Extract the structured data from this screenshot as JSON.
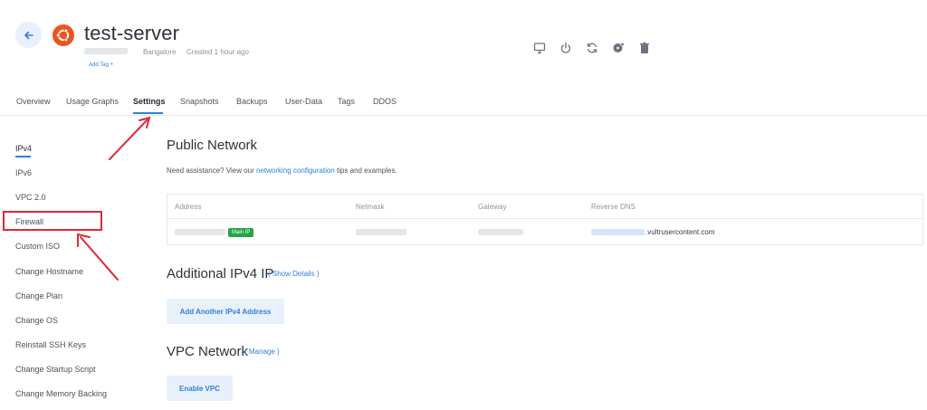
{
  "header": {
    "server_name": "test-server",
    "location": "Bangalore",
    "created": "Created 1 hour ago",
    "add_tag": "Add Tag +"
  },
  "toolbar": {
    "icons": [
      "console-icon",
      "power-icon",
      "restart-icon",
      "iso-icon",
      "trash-icon"
    ]
  },
  "tabs": [
    {
      "label": "Overview"
    },
    {
      "label": "Usage Graphs"
    },
    {
      "label": "Settings",
      "active": true
    },
    {
      "label": "Snapshots"
    },
    {
      "label": "Backups"
    },
    {
      "label": "User-Data"
    },
    {
      "label": "Tags"
    },
    {
      "label": "DDOS"
    }
  ],
  "sidebar": {
    "items": [
      {
        "label": "IPv4",
        "active": true
      },
      {
        "label": "IPv6"
      },
      {
        "label": "VPC 2.0"
      },
      {
        "label": "Firewall"
      },
      {
        "label": "Custom ISO"
      },
      {
        "label": "Change Hostname"
      },
      {
        "label": "Change Plan"
      },
      {
        "label": "Change OS"
      },
      {
        "label": "Reinstall SSH Keys"
      },
      {
        "label": "Change Startup Script"
      },
      {
        "label": "Change Memory Backing"
      }
    ]
  },
  "public_network": {
    "title": "Public Network",
    "note_prefix": "Need assistance? View our ",
    "note_link": "networking configuration",
    "note_suffix": " tips and examples.",
    "columns": [
      "Address",
      "Netmask",
      "Gateway",
      "Reverse DNS"
    ],
    "badge": "Main IP",
    "reverse_dns_suffix": ".vultrusercontent.com"
  },
  "additional_ipv4": {
    "title": "Additional IPv4 IP",
    "show_details": "( Show Details )",
    "add_button": "Add Another IPv4 Address"
  },
  "vpc_network": {
    "title": "VPC Network",
    "manage": "( Manage )",
    "enable_button": "Enable VPC"
  },
  "colors": {
    "accent": "#2f7fdc",
    "annotation": "#e0273a",
    "badge": "#22a447",
    "ubuntu": "#e95420"
  }
}
